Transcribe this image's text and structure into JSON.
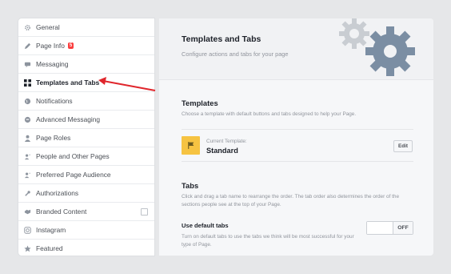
{
  "sidebar": {
    "items": [
      {
        "label": "General",
        "icon": "gear-icon"
      },
      {
        "label": "Page Info",
        "icon": "pencil-icon",
        "badge": "5"
      },
      {
        "label": "Messaging",
        "icon": "chat-icon"
      },
      {
        "label": "Templates and Tabs",
        "icon": "grid-icon"
      },
      {
        "label": "Notifications",
        "icon": "globe-icon"
      },
      {
        "label": "Advanced Messaging",
        "icon": "chat-bubble-icon"
      },
      {
        "label": "Page Roles",
        "icon": "person-icon"
      },
      {
        "label": "People and Other Pages",
        "icon": "people-icon"
      },
      {
        "label": "Preferred Page Audience",
        "icon": "people-icon"
      },
      {
        "label": "Authorizations",
        "icon": "wrench-icon"
      },
      {
        "label": "Branded Content",
        "icon": "handshake-icon"
      },
      {
        "label": "Instagram",
        "icon": "instagram-icon"
      },
      {
        "label": "Featured",
        "icon": "star-icon"
      }
    ]
  },
  "header": {
    "title": "Templates and Tabs",
    "subtitle": "Configure actions and tabs for your page"
  },
  "templates": {
    "title": "Templates",
    "description": "Choose a template with default buttons and tabs designed to help your Page.",
    "current_label": "Current Template:",
    "current_value": "Standard",
    "edit_label": "Edit"
  },
  "tabs": {
    "title": "Tabs",
    "description": "Click and drag a tab name to rearrange the order. The tab order also determines the order of the sections people see at the top of your Page.",
    "use_default_title": "Use default tabs",
    "use_default_desc": "Turn on default tabs to use the tabs we think will be most successful for your type of Page.",
    "toggle_state": "OFF"
  },
  "colors": {
    "accent_arrow": "#e0262c",
    "gear_dark": "#7b8ea3",
    "gear_light": "#c9cdd2",
    "template_icon": "#f6c342"
  }
}
